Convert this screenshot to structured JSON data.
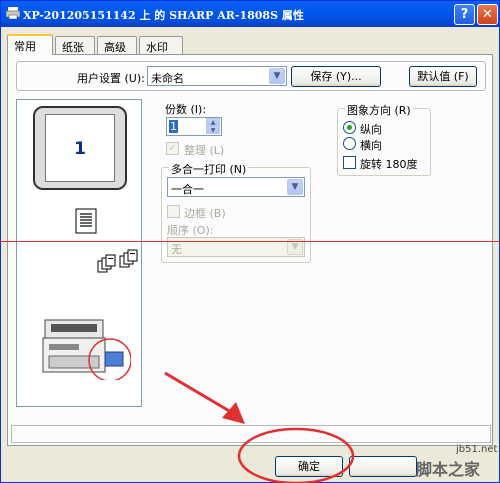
{
  "window": {
    "title": "XP-201205151142 上 的 SHARP AR-1808S 属性",
    "help_glyph": "?",
    "close_glyph": "✕"
  },
  "tabs": [
    {
      "label": "常用",
      "active": true
    },
    {
      "label": "纸张",
      "active": false
    },
    {
      "label": "高级",
      "active": false
    },
    {
      "label": "水印",
      "active": false
    }
  ],
  "user_settings": {
    "label": "用户设置 (U):",
    "value": "未命名",
    "save_label": "保存 (Y)...",
    "default_label": "默认值 (F)"
  },
  "preview": {
    "page_number": "1"
  },
  "copies": {
    "label": "份数 (I):",
    "value": "1"
  },
  "collate": {
    "label": "整理 (L)",
    "checked": true,
    "enabled": false
  },
  "nup": {
    "group_label": "多合一打印 (N)",
    "value": "一合一",
    "border_label": "边框 (B)",
    "order_label": "顺序 (O):",
    "order_value": "无"
  },
  "orientation": {
    "group_label": "图象方向 (R)",
    "portrait_label": "纵向",
    "landscape_label": "横向",
    "selected": "portrait",
    "rotate_label": "旋转 180度"
  },
  "footer": {
    "ok_label": "确定"
  },
  "watermark": {
    "url": "jb51.net",
    "logo": "脚本之家"
  },
  "colors": {
    "title_bar": "#0058ee",
    "dialog_bg": "#ece9d8",
    "annotation_red": "#e03131"
  }
}
